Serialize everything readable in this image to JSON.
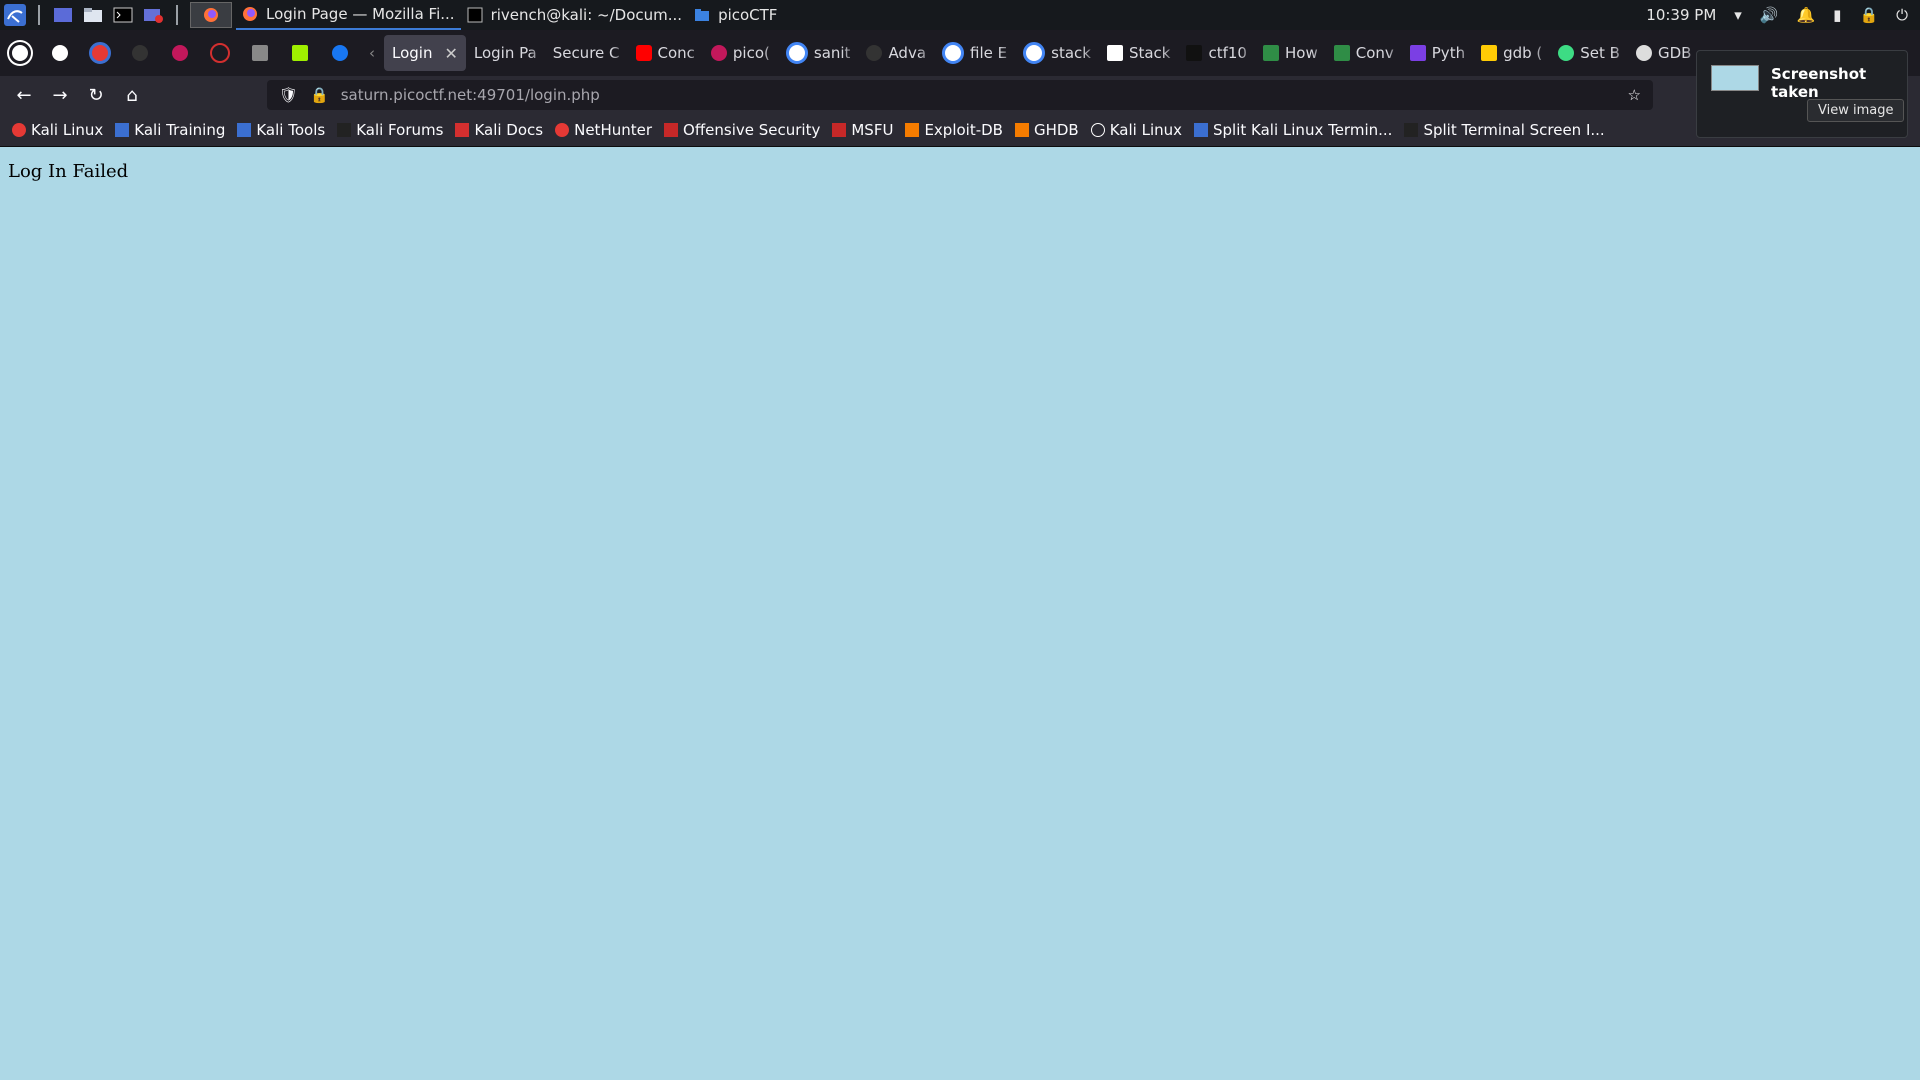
{
  "taskbar": {
    "windows": [
      {
        "label": "Login Page — Mozilla Fi..."
      },
      {
        "label": "rivench@kali: ~/Docum..."
      },
      {
        "label": "picoCTF"
      }
    ],
    "clock": "10:39 PM"
  },
  "tabs": [
    {
      "label": "Login",
      "selected": true
    },
    {
      "label": "Login Pa"
    },
    {
      "label": "Secure C"
    },
    {
      "label": "Conc"
    },
    {
      "label": "pico("
    },
    {
      "label": "sanit"
    },
    {
      "label": "Adva"
    },
    {
      "label": "file E"
    },
    {
      "label": "stack"
    },
    {
      "label": "Stack"
    },
    {
      "label": "ctf10"
    },
    {
      "label": "How"
    },
    {
      "label": "Conv"
    },
    {
      "label": "Pyth"
    },
    {
      "label": "gdb ("
    },
    {
      "label": "Set B"
    },
    {
      "label": "GDB"
    }
  ],
  "navbar": {
    "url_host": "saturn.picoctf.net",
    "url_rest": ":49701/login.php"
  },
  "bookmarks": [
    {
      "label": "Kali Linux"
    },
    {
      "label": "Kali Training"
    },
    {
      "label": "Kali Tools"
    },
    {
      "label": "Kali Forums"
    },
    {
      "label": "Kali Docs"
    },
    {
      "label": "NetHunter"
    },
    {
      "label": "Offensive Security"
    },
    {
      "label": "MSFU"
    },
    {
      "label": "Exploit-DB"
    },
    {
      "label": "GHDB"
    },
    {
      "label": "Kali Linux"
    },
    {
      "label": "Split Kali Linux Termin..."
    },
    {
      "label": "Split Terminal Screen I..."
    }
  ],
  "page": {
    "message": "Log In Failed"
  },
  "notification": {
    "title": "Screenshot taken",
    "button": "View image"
  }
}
